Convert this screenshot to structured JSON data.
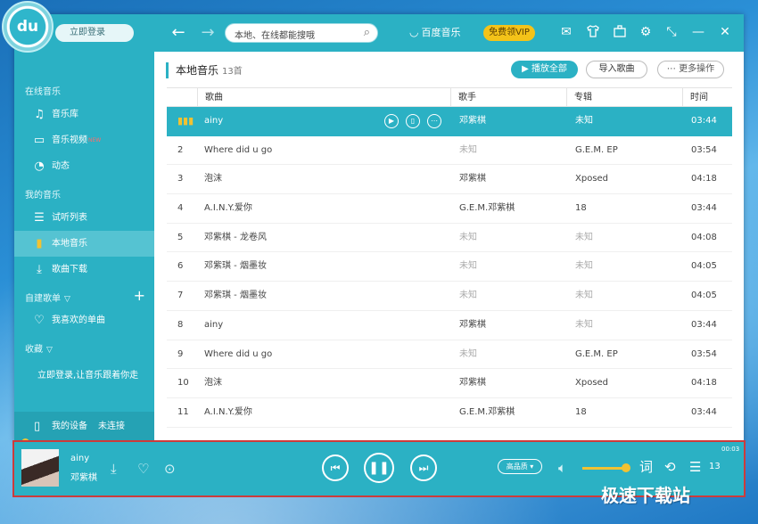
{
  "app": {
    "logo_text": "du",
    "login_label": "立即登录",
    "back_glyph": "←",
    "forward_glyph": "→",
    "search_placeholder": "本地、在线都能搜哦",
    "brand_name": "百度音乐",
    "vip_label": "免费领VIP",
    "top_icons": [
      "mail-icon",
      "skin-icon",
      "toolbox-icon",
      "settings-icon",
      "minimize-mode-icon",
      "close-icon"
    ]
  },
  "sidebar": {
    "online_head": "在线音乐",
    "online_items": [
      {
        "label": "音乐库",
        "icon": "♫"
      },
      {
        "label": "音乐视频",
        "icon": "▭",
        "badge": "NEW"
      },
      {
        "label": "动态",
        "icon": "◔"
      }
    ],
    "my_head": "我的音乐",
    "my_items": [
      {
        "label": "试听列表",
        "icon": "☰"
      },
      {
        "label": "本地音乐",
        "icon": "▮"
      },
      {
        "label": "歌曲下载",
        "icon": "⤓"
      }
    ],
    "playlist_head": "自建歌单",
    "playlist_items": [
      {
        "label": "我喜欢的单曲",
        "icon": "♡"
      }
    ],
    "fav_head": "收藏",
    "login_note": "立即登录,让音乐跟着你走",
    "device_label": "我的设备",
    "device_status": "未连接"
  },
  "content": {
    "title": "本地音乐",
    "count": "13首",
    "play_all_label": "播放全部",
    "import_label": "导入歌曲",
    "more_label": "更多操作",
    "columns": {
      "title": "歌曲",
      "artist": "歌手",
      "album": "专辑",
      "time": "时间"
    },
    "rows": [
      {
        "idx": "",
        "title": "ainy",
        "artist": "邓紫棋",
        "album": "未知",
        "time": "03:44"
      },
      {
        "idx": "2",
        "title": "Where did u go",
        "artist": "未知",
        "album": "G.E.M. EP",
        "time": "03:54"
      },
      {
        "idx": "3",
        "title": "泡沫",
        "artist": "邓紫棋",
        "album": "Xposed",
        "time": "04:18"
      },
      {
        "idx": "4",
        "title": "A.I.N.Y.爱你",
        "artist": "G.E.M.邓紫棋",
        "album": "18",
        "time": "03:44"
      },
      {
        "idx": "5",
        "title": "邓紫棋 - 龙卷风",
        "artist": "未知",
        "album": "未知",
        "time": "04:08"
      },
      {
        "idx": "6",
        "title": "邓紫琪 - 烟墨妆",
        "artist": "未知",
        "album": "未知",
        "time": "04:05"
      },
      {
        "idx": "7",
        "title": "邓紫琪 - 烟墨妆",
        "artist": "未知",
        "album": "未知",
        "time": "04:05"
      },
      {
        "idx": "8",
        "title": "ainy",
        "artist": "邓紫棋",
        "album": "未知",
        "time": "03:44"
      },
      {
        "idx": "9",
        "title": "Where did u go",
        "artist": "未知",
        "album": "G.E.M. EP",
        "time": "03:54"
      },
      {
        "idx": "10",
        "title": "泡沫",
        "artist": "邓紫棋",
        "album": "Xposed",
        "time": "04:18"
      },
      {
        "idx": "11",
        "title": "A.I.N.Y.爱你",
        "artist": "G.E.M.邓紫棋",
        "album": "18",
        "time": "03:44"
      }
    ]
  },
  "player": {
    "song": "ainy",
    "artist": "邓紫棋",
    "quality_label": "高品质",
    "elapsed": "00:03",
    "lyrics_glyph": "词",
    "queue_count": "13",
    "volume_level": 1.0
  },
  "watermark": "极速下载站",
  "colors": {
    "accent": "#2bb1c4",
    "highlight": "#f1c232",
    "vip": "#f4c319",
    "frame": "#cc3b3b"
  }
}
